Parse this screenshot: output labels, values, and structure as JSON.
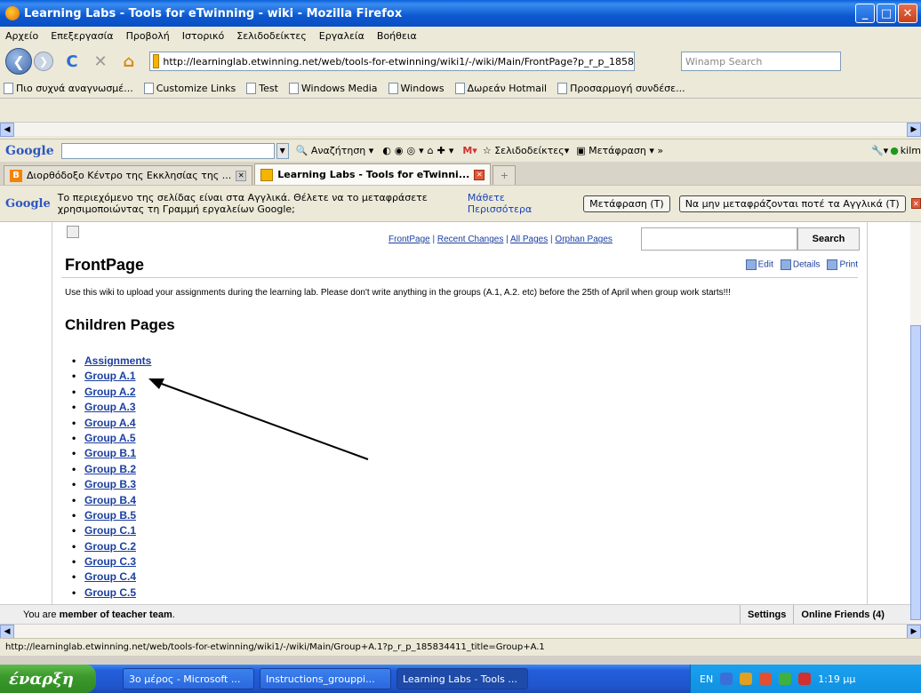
{
  "window": {
    "title": "Learning Labs - Tools for eTwinning - wiki - Mozilla Firefox"
  },
  "menu": [
    "Αρχείο",
    "Επεξεργασία",
    "Προβολή",
    "Ιστορικό",
    "Σελιδοδείκτες",
    "Εργαλεία",
    "Βοήθεια"
  ],
  "nav": {
    "url": "http://learninglab.etwinning.net/web/tools-for-etwinning/wiki1/-/wiki/Main/FrontPage?p_r_p_1858",
    "search_placeholder": "Winamp Search"
  },
  "bookmarks": [
    "Πιο συχνά αναγνωσμέ...",
    "Customize Links",
    "Test",
    "Windows Media",
    "Windows",
    "Δωρεάν Hotmail",
    "Προσαρμογή συνδέσε..."
  ],
  "gtoolbar": {
    "logo": "Google",
    "search_label": "Αναζήτηση",
    "bookmarks_label": "Σελιδοδείκτες",
    "translate_label": "Μετάφραση",
    "user": "kilm"
  },
  "tabs": [
    {
      "label": "Διορθόδοξο Κέντρο της Εκκλησίας της ...",
      "active": false
    },
    {
      "label": "Learning Labs - Tools for eTwinni...",
      "active": true
    }
  ],
  "translate_bar": {
    "logo": "Google",
    "message": "Το περιεχόμενο της σελίδας είναι στα Αγγλικά. Θέλετε να το μεταφράσετε χρησιμοποιώντας τη Γραμμή εργαλείων Google;",
    "learn_more": "Μάθετε Περισσότερα",
    "translate_btn": "Μετάφραση (T)",
    "never_btn": "Να μην μεταφράζονται ποτέ τα Αγγλικά (T)"
  },
  "wiki": {
    "links": {
      "frontpage": "FrontPage",
      "recent": "Recent Changes",
      "all": "All Pages",
      "orphan": "Orphan Pages",
      "sep": "|"
    },
    "search_btn": "Search",
    "page_title": "FrontPage",
    "actions": {
      "edit": "Edit",
      "details": "Details",
      "print": "Print"
    },
    "intro": "Use this wiki to upload your assignments during the learning lab. Please don't write anything in the groups (A.1, A.2. etc) before the 25th of April when group work starts!!!",
    "children_heading": "Children Pages",
    "children": [
      "Assignments",
      "Group A.1",
      "Group A.2",
      "Group A.3",
      "Group A.4",
      "Group A.5",
      "Group B.1",
      "Group B.2",
      "Group B.3",
      "Group B.4",
      "Group B.5",
      "Group C.1",
      "Group C.2",
      "Group C.3",
      "Group C.4",
      "Group C.5"
    ],
    "member_prefix": "You are ",
    "member_bold": "member of teacher team",
    "member_suffix": ".",
    "settings": "Settings",
    "online_friends": "Online Friends (4)"
  },
  "statusbar": {
    "text": "http://learninglab.etwinning.net/web/tools-for-etwinning/wiki1/-/wiki/Main/Group+A.1?p_r_p_185834411_title=Group+A.1"
  },
  "taskbar": {
    "start": "έναρξη",
    "items": [
      "3ο μέρος - Microsoft ...",
      "Instructions_grouppi...",
      "Learning Labs - Tools ..."
    ],
    "lang": "EN",
    "clock": "1:19 μμ"
  },
  "colors": {
    "link": "#1a3fa0",
    "titlebar": "#0a5fd8",
    "taskbar": "#245edb",
    "start": "#3c9a2c"
  }
}
